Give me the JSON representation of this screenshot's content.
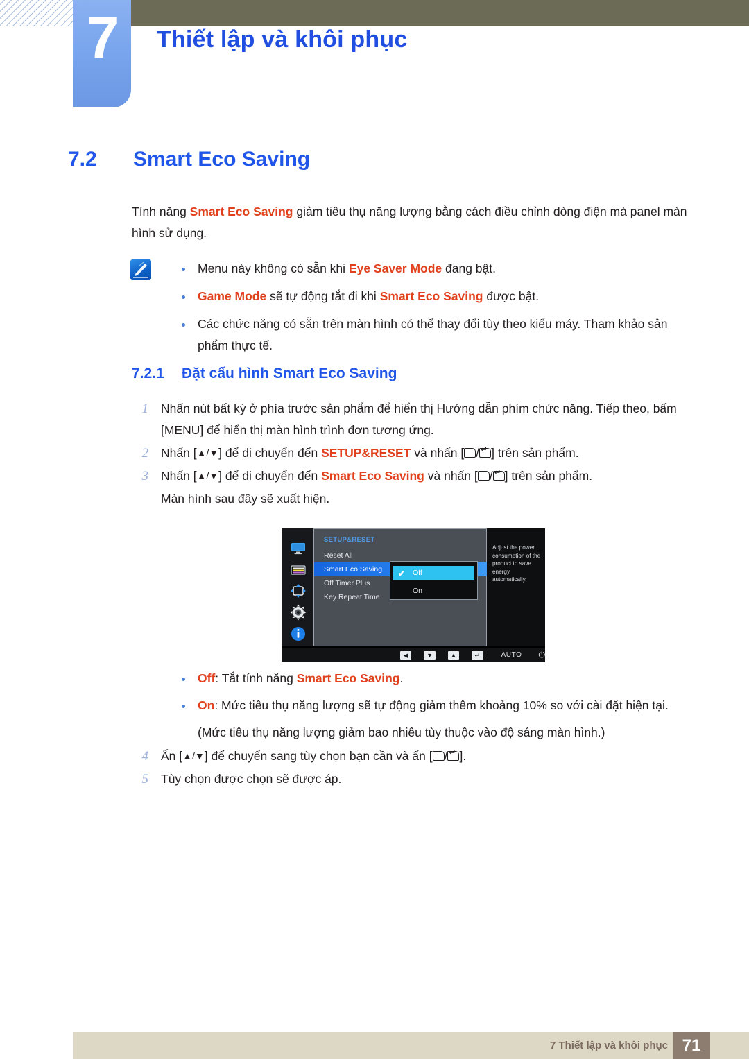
{
  "header": {
    "chapter_number": "7",
    "chapter_title": "Thiết lập và khôi phục"
  },
  "section": {
    "number": "7.2",
    "title": "Smart Eco Saving"
  },
  "intro": {
    "before": "Tính năng ",
    "highlight": "Smart Eco Saving",
    "after": " giảm tiêu thụ năng lượng bằng cách điều chỉnh dòng điện mà panel màn hình sử dụng."
  },
  "notes": {
    "icon": "note-pen-icon",
    "items": [
      {
        "p1": "Menu này không có sẵn khi ",
        "b1": "Eye Saver Mode",
        "p2": " đang bật.",
        "b2": "",
        "p3": ""
      },
      {
        "p1": "",
        "b1": "Game Mode",
        "p2": " sẽ tự động tắt đi khi ",
        "b2": "Smart Eco Saving",
        "p3": " được bật."
      },
      {
        "p1": "Các chức năng có sẵn trên màn hình có thể thay đổi tùy theo kiểu máy. Tham khảo sản phẩm thực tế.",
        "b1": "",
        "p2": "",
        "b2": "",
        "p3": ""
      }
    ]
  },
  "subsection": {
    "number": "7.2.1",
    "title": "Đặt cấu hình Smart Eco Saving"
  },
  "steps": [
    {
      "num": "1",
      "t1": "Nhấn nút bất kỳ ở phía trước sản phẩm để hiển thị Hướng dẫn phím chức năng. Tiếp theo, bấm [MENU] để hiển thị màn hình trình đơn tương ứng.",
      "t2": "",
      "t3": "",
      "t4": ""
    },
    {
      "num": "2",
      "t1": "Nhấn [",
      "t2": "] để di chuyển đến ",
      "t3": "SETUP&RESET",
      "t4": " và nhấn ["
    },
    {
      "num": "3",
      "t1": "Nhấn [",
      "t2": "] để di chuyển đến ",
      "t3": "Smart Eco Saving",
      "t4": " và nhấn ["
    }
  ],
  "step_tail": "] trên sản phẩm.",
  "step3_note": "Màn hình sau đây sẽ xuất hiện.",
  "arrows": "▲/▼",
  "osd": {
    "menu_title": "SETUP&RESET",
    "menu_items": [
      {
        "label": "Reset All",
        "active": false
      },
      {
        "label": "Smart Eco Saving",
        "active": true
      },
      {
        "label": "Off Timer Plus",
        "active": false
      },
      {
        "label": "Key Repeat Time",
        "active": false
      }
    ],
    "popup_options": [
      {
        "label": "Off",
        "selected": true
      },
      {
        "label": "On",
        "selected": false
      }
    ],
    "check_mark": "✔",
    "description": "Adjust the power consumption of the product to save energy automatically.",
    "sidebar_icons": [
      "monitor-icon",
      "picture-color-icon",
      "position-arrows-icon",
      "gear-setup-icon",
      "information-icon"
    ],
    "toolbar": {
      "left_button": "◀",
      "down_button": "▼",
      "up_button": "▲",
      "enter_button": "↵",
      "auto_label": "AUTO",
      "power_icon": "⏻"
    },
    "colors": {
      "highlight_blue": "#2a86f0",
      "popup_cyan": "#2ec2f0",
      "menu_title_blue": "#4f9ae8"
    }
  },
  "options": [
    {
      "b1": "Off",
      "p1": ": Tắt tính năng ",
      "b2": "Smart Eco Saving",
      "p2": "."
    },
    {
      "b1": "On",
      "p1": ": Mức tiêu thụ năng lượng sẽ tự động giảm thêm khoảng 10% so với cài đặt hiện tại.",
      "b2": "",
      "p2": ""
    }
  ],
  "options_note": "(Mức tiêu thụ năng lượng giảm bao nhiêu tùy thuộc vào độ sáng màn hình.)",
  "steps2": [
    {
      "num": "4",
      "t1": "Ấn [",
      "t2": "] để chuyển sang tùy chọn bạn cần và ấn [",
      "t3": "]."
    },
    {
      "num": "5",
      "t1": "Tùy chọn được chọn sẽ được áp.",
      "t2": "",
      "t3": ""
    }
  ],
  "footer": {
    "text": "7 Thiết lập và khôi phục",
    "page": "71"
  },
  "colors": {
    "heading_blue": "#1f55e8",
    "accent_red": "#e1411d",
    "header_olive": "#6c6c56",
    "tab_blue": "#7aa6ee",
    "footer_beige": "#ddd7c5",
    "footer_brown": "#8d7d71"
  }
}
